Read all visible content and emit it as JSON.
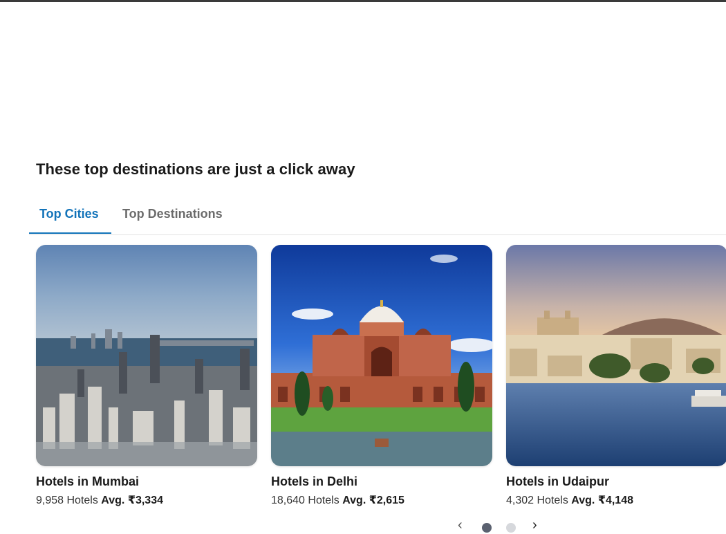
{
  "section": {
    "title": "These top destinations are just a click away"
  },
  "tabs": [
    {
      "label": "Top Cities",
      "active": true
    },
    {
      "label": "Top Destinations",
      "active": false
    }
  ],
  "cards": [
    {
      "title": "Hotels in Mumbai",
      "hotels": "9,958 Hotels",
      "avg_label": "Avg.",
      "avg_price": "₹3,334",
      "image": "mumbai-skyline"
    },
    {
      "title": "Hotels in Delhi",
      "hotels": "18,640 Hotels",
      "avg_label": "Avg.",
      "avg_price": "₹2,615",
      "image": "humayuns-tomb"
    },
    {
      "title": "Hotels in Udaipur",
      "hotels": "4,302 Hotels",
      "avg_label": "Avg.",
      "avg_price": "₹4,148",
      "image": "udaipur-lake-palace"
    }
  ],
  "carousel": {
    "prev_icon": "chevron-left-icon",
    "next_icon": "chevron-right-icon",
    "pages": 2,
    "current_page": 1
  },
  "colors": {
    "accent": "#1273b9",
    "tab_inactive": "#6b6b6b",
    "text": "#1a1a1a"
  }
}
